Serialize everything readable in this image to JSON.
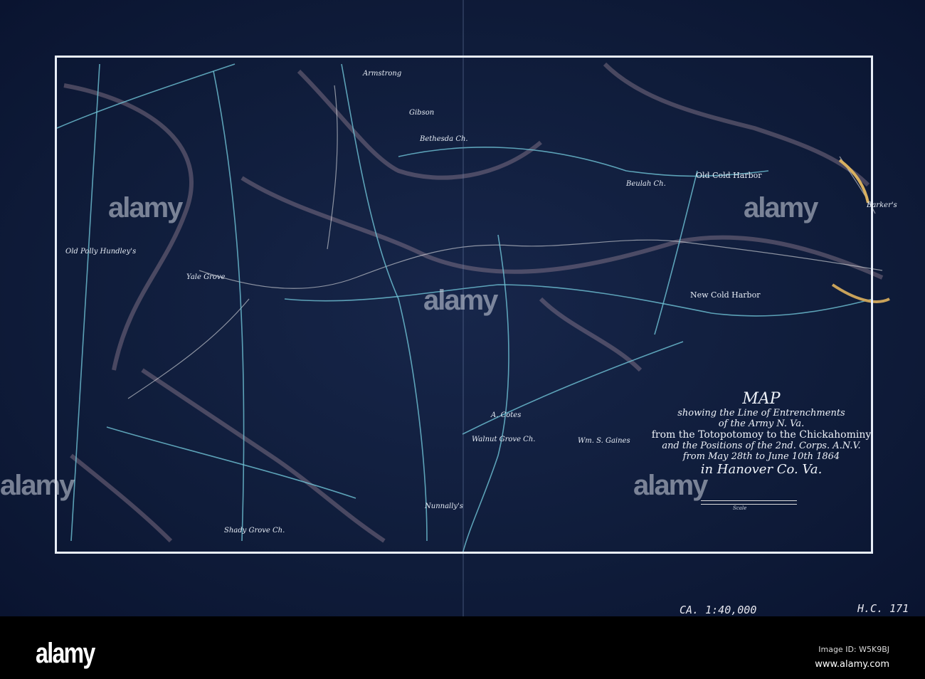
{
  "map": {
    "title": {
      "line1": "MAP",
      "line2": "showing the Line of Entrenchments",
      "line3": "of the Army N. Va.",
      "line4": "from the Totopotomoy to the Chickahominy",
      "line5": "and the Positions of the 2nd. Corps. A.N.V.",
      "line6": "from May 28th to June 10th 1864",
      "line7": "in Hanover Co. Va."
    },
    "scale_label": "Scale",
    "places": [
      "Old Cold Harbor",
      "New Cold Harbor",
      "Walnut Grove Ch.",
      "Nunnally's",
      "Shady Grove Ch.",
      "Old Polly Hundley's",
      "Gibson",
      "Barker's",
      "Wm. S. Gaines",
      "A. Cotes",
      "Beulah Ch.",
      "Armstrong",
      "Bethesda Ch.",
      "Yale Grove"
    ],
    "annotations": {
      "scale_note": "CA. 1:40,000",
      "catalog": "H.C. 171"
    },
    "colors": {
      "paper": "#0f1c3a",
      "lines": "#e8eef8",
      "roads": "#6fc3d6"
    }
  },
  "watermark": "alamy",
  "banner": {
    "logo": "alamy",
    "image_id": "Image ID: W5K9BJ",
    "website": "www.alamy.com"
  }
}
